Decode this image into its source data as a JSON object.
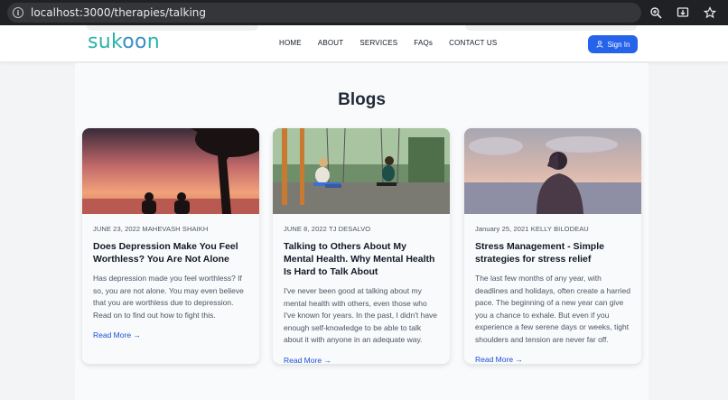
{
  "browser": {
    "url": "localhost:3000/therapies/talking"
  },
  "header": {
    "logo_prefix": "suk",
    "logo_oo": "oo",
    "logo_suffix": "n",
    "nav": [
      "HOME",
      "ABOUT",
      "SERVICES",
      "FAQs",
      "CONTACT US"
    ],
    "signin_label": "Sign In"
  },
  "page": {
    "title": "Blogs"
  },
  "posts": [
    {
      "meta": "JUNE 23, 2022 MAHEVASH SHAIKH",
      "title": "Does Depression Make You Feel Worthless? You Are Not Alone",
      "excerpt": "Has depression made you feel worthless? If so, you are not alone. You may even believe that you are worthless due to depression. Read on to find out how to fight this.",
      "link": "Read More →"
    },
    {
      "meta": "JUNE 8, 2022 TJ DESALVO",
      "title": "Talking to Others About My Mental Health. Why Mental Health Is Hard to Talk About",
      "excerpt": "I've never been good at talking about my mental health with others, even those who I've known for years. In the past, I didn't have enough self-knowledge to be able to talk about it with anyone in an adequate way.",
      "link": "Read More →"
    },
    {
      "meta": "January 25, 2021 KELLY BILODEAU",
      "title": "Stress Management - Simple strategies for stress relief",
      "excerpt": "The last few months of any year, with deadlines and holidays, often create a harried pace. The beginning of a new year can give you a chance to exhale. But even if you experience a few serene days or weeks, tight shoulders and tension are never far off.",
      "link": "Read More →"
    }
  ],
  "colors": {
    "accent": "#2563eb",
    "logo_teal": "#2bb3a8",
    "logo_blue": "#3a8dc7",
    "link": "#1d4ed8"
  }
}
